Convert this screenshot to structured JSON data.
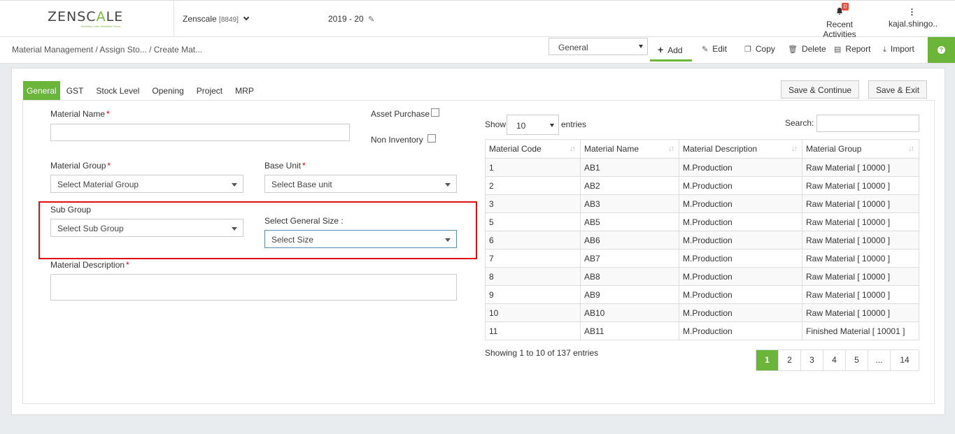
{
  "header": {
    "logo_text_a": "ZENSC",
    "logo_text_accent": "A",
    "logo_text_b": "LE",
    "logo_tagline": "Business Loss. Business Focus.",
    "company_name": "Zenscale",
    "company_code": "[8849]",
    "financial_year": "2019 - 20",
    "notification_count": "0",
    "recent_activities": "Recent Activities",
    "user_name": "kajal.shingo.."
  },
  "toolbar": {
    "breadcrumb": "Material Management  / Assign Sto... / Create Mat...",
    "mode_selected": "General",
    "add": "Add",
    "edit": "Edit",
    "copy": "Copy",
    "delete": "Delete",
    "report": "Report",
    "import": "Import"
  },
  "tabs": [
    "General",
    "GST",
    "Stock Level",
    "Opening",
    "Project",
    "MRP"
  ],
  "actions": {
    "save_continue": "Save & Continue",
    "save_exit": "Save & Exit"
  },
  "form": {
    "material_name_label": "Material Name",
    "asset_purchase_label": "Asset Purchase",
    "non_inventory_label": "Non Inventory",
    "material_group_label": "Material Group",
    "material_group_placeholder": "Select Material Group",
    "base_unit_label": "Base Unit",
    "base_unit_placeholder": "Select Base unit",
    "sub_group_label": "Sub Group",
    "sub_group_placeholder": "Select Sub Group",
    "general_size_label": "Select General Size :",
    "general_size_placeholder": "Select Size",
    "description_label": "Material Description",
    "required_mark": "*"
  },
  "table": {
    "show_label": "Show",
    "page_length": "10",
    "entries_label": "entries",
    "search_label": "Search:",
    "columns": [
      "Material Code",
      "Material Name",
      "Material Description",
      "Material Group"
    ],
    "rows": [
      [
        "1",
        "AB1",
        "M.Production",
        "Raw Material [ 10000 ]"
      ],
      [
        "2",
        "AB2",
        "M.Production",
        "Raw Material [ 10000 ]"
      ],
      [
        "3",
        "AB3",
        "M.Production",
        "Raw Material [ 10000 ]"
      ],
      [
        "5",
        "AB5",
        "M.Production",
        "Raw Material [ 10000 ]"
      ],
      [
        "6",
        "AB6",
        "M.Production",
        "Raw Material [ 10000 ]"
      ],
      [
        "7",
        "AB7",
        "M.Production",
        "Raw Material [ 10000 ]"
      ],
      [
        "8",
        "AB8",
        "M.Production",
        "Raw Material [ 10000 ]"
      ],
      [
        "9",
        "AB9",
        "M.Production",
        "Raw Material [ 10000 ]"
      ],
      [
        "10",
        "AB10",
        "M.Production",
        "Raw Material [ 10000 ]"
      ],
      [
        "11",
        "AB11",
        "M.Production",
        "Finished Material [ 10001 ]"
      ]
    ],
    "info": "Showing 1 to 10 of 137 entries",
    "pages": [
      "1",
      "2",
      "3",
      "4",
      "5",
      "...",
      "14"
    ]
  },
  "colors": {
    "accent": "#6bb53a",
    "highlight": "#e01010"
  }
}
